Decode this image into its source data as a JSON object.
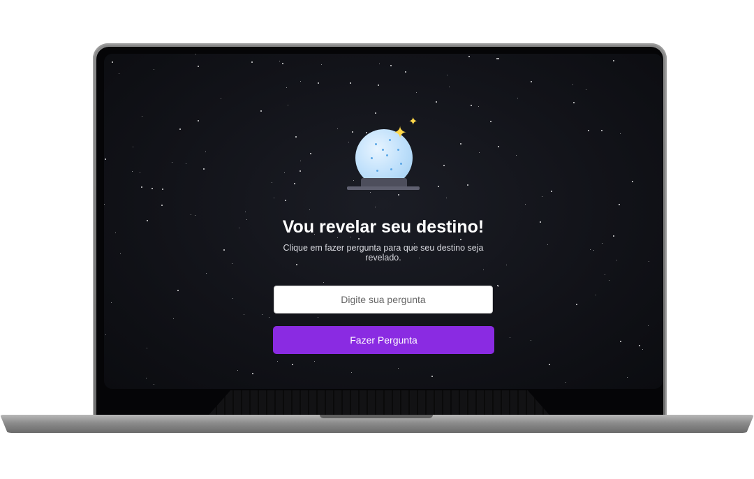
{
  "app": {
    "title": "Vou revelar seu destino!",
    "subtitle": "Clique em fazer pergunta para que seu destino seja revelado."
  },
  "question": {
    "placeholder": "Digite sua pergunta",
    "value": ""
  },
  "actions": {
    "ask_label": "Fazer Pergunta"
  },
  "icons": {
    "hero": "crystal-ball-icon",
    "sparkles": "sparkle-icon"
  },
  "colors": {
    "background": "#121319",
    "accent": "#8a2be2",
    "orb": "#bfe0fb",
    "sparkle": "#ffd84a"
  }
}
